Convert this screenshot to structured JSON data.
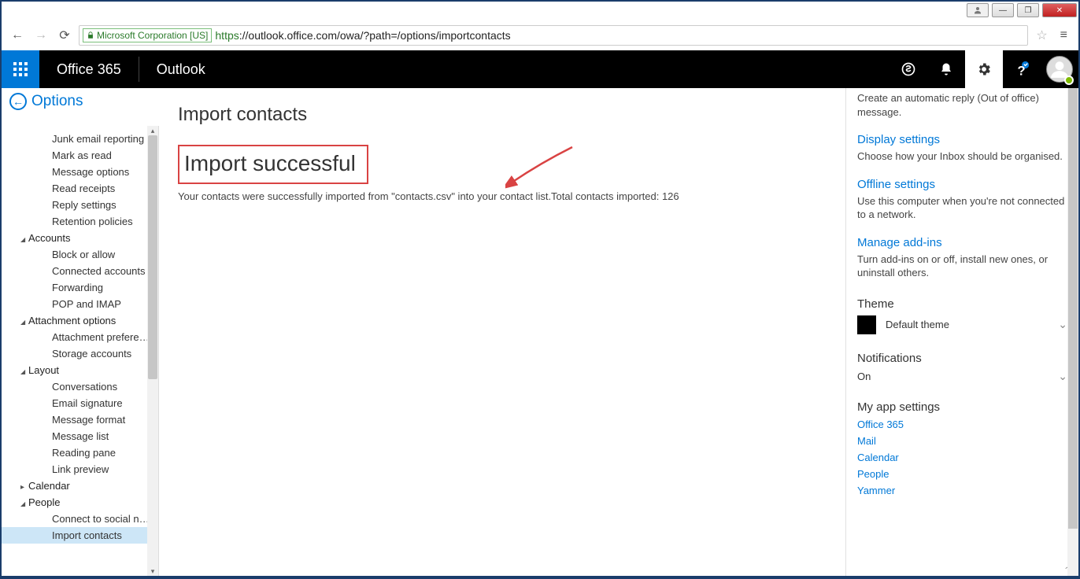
{
  "window": {
    "user_btn": "👤",
    "minimize": "—",
    "maximize": "❐",
    "close": "✕"
  },
  "browser": {
    "badge": "Microsoft Corporation [US]",
    "url_scheme": "https",
    "url_rest": "://outlook.office.com/owa/?path=/options/importcontacts"
  },
  "topbar": {
    "brand": "Office 365",
    "app": "Outlook"
  },
  "options_title": "Options",
  "left_nav": {
    "items": [
      {
        "label": "Junk email reporting",
        "level": 2
      },
      {
        "label": "Mark as read",
        "level": 2
      },
      {
        "label": "Message options",
        "level": 2
      },
      {
        "label": "Read receipts",
        "level": 2
      },
      {
        "label": "Reply settings",
        "level": 2
      },
      {
        "label": "Retention policies",
        "level": 2
      },
      {
        "label": "Accounts",
        "level": 1,
        "open": true
      },
      {
        "label": "Block or allow",
        "level": 2
      },
      {
        "label": "Connected accounts",
        "level": 2
      },
      {
        "label": "Forwarding",
        "level": 2
      },
      {
        "label": "POP and IMAP",
        "level": 2
      },
      {
        "label": "Attachment options",
        "level": 1,
        "open": true
      },
      {
        "label": "Attachment preference",
        "level": 2
      },
      {
        "label": "Storage accounts",
        "level": 2
      },
      {
        "label": "Layout",
        "level": 1,
        "open": true
      },
      {
        "label": "Conversations",
        "level": 2
      },
      {
        "label": "Email signature",
        "level": 2
      },
      {
        "label": "Message format",
        "level": 2
      },
      {
        "label": "Message list",
        "level": 2
      },
      {
        "label": "Reading pane",
        "level": 2
      },
      {
        "label": "Link preview",
        "level": 2
      },
      {
        "label": "Calendar",
        "level": 1,
        "open": false
      },
      {
        "label": "People",
        "level": 1,
        "open": true
      },
      {
        "label": "Connect to social networ",
        "level": 2
      },
      {
        "label": "Import contacts",
        "level": 2,
        "selected": true
      }
    ]
  },
  "main": {
    "heading": "Import contacts",
    "result_heading": "Import successful",
    "result_desc": "Your contacts were successfully imported from \"contacts.csv\" into your contact list.Total contacts imported: 126"
  },
  "right": {
    "auto_reply_desc": "Create an automatic reply (Out of office) message.",
    "display": {
      "title": "Display settings",
      "desc": "Choose how your Inbox should be organised."
    },
    "offline": {
      "title": "Offline settings",
      "desc": "Use this computer when you're not connected to a network."
    },
    "addins": {
      "title": "Manage add-ins",
      "desc": "Turn add-ins on or off, install new ones, or uninstall others."
    },
    "theme_label": "Theme",
    "theme_value": "Default theme",
    "notifications_label": "Notifications",
    "notifications_value": "On",
    "myapp_label": "My app settings",
    "app_links": [
      "Office 365",
      "Mail",
      "Calendar",
      "People",
      "Yammer"
    ]
  }
}
